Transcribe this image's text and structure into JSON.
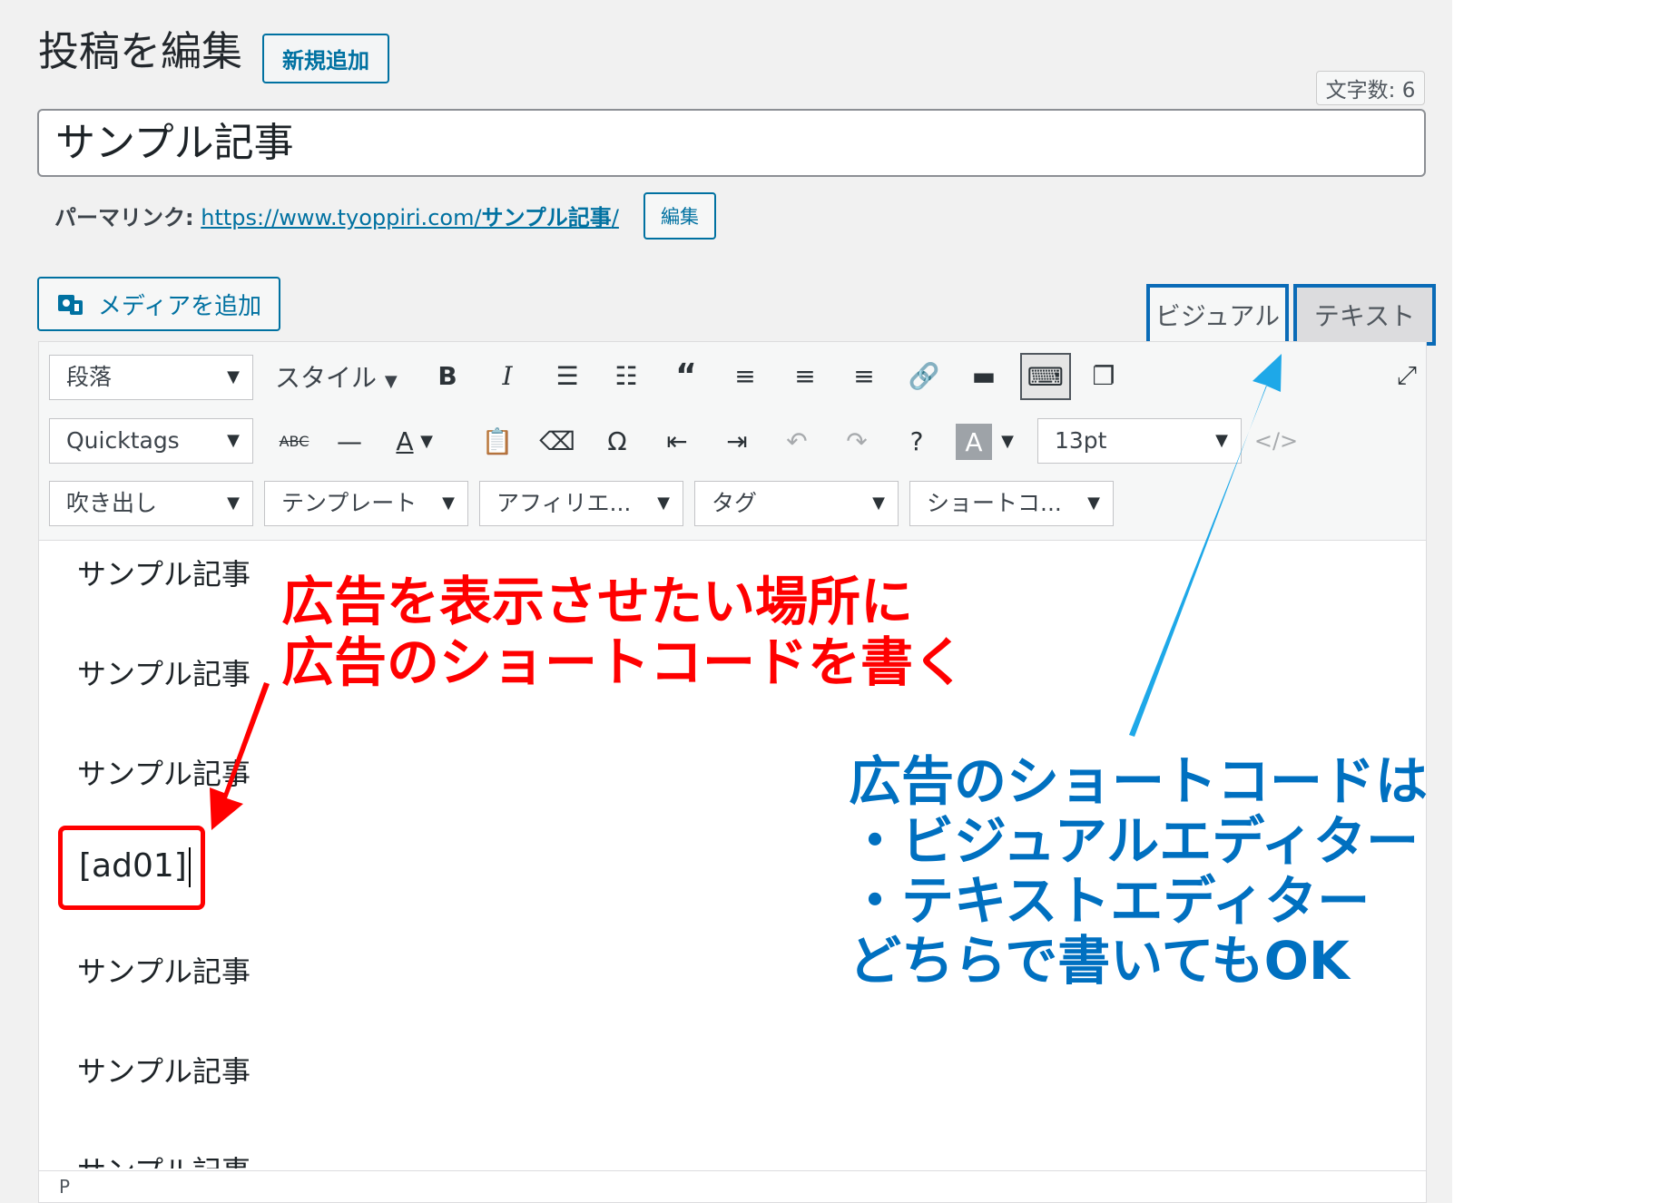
{
  "header": {
    "title": "投稿を編集",
    "add_new_label": "新規追加",
    "word_count": "文字数: 6"
  },
  "post": {
    "title": "サンプル記事"
  },
  "permalink": {
    "label": "パーマリンク:",
    "url_base": "https://www.tyoppiri.com/",
    "slug": "サンプル記事",
    "url_tail": "/",
    "edit_label": "編集"
  },
  "media": {
    "add_label": "メディアを追加"
  },
  "editor_tabs": {
    "visual": "ビジュアル",
    "text": "テキスト"
  },
  "toolbar": {
    "format_select": "段落",
    "styles_label": "スタイル",
    "quicktags_select": "Quicktags",
    "font_size_select": "13pt",
    "row3": [
      "吹き出し",
      "テンプレート",
      "アフィリエ...",
      "タグ",
      "ショートコ..."
    ]
  },
  "content": {
    "paragraphs": [
      "サンプル記事",
      "サンプル記事",
      "サンプル記事",
      "[ad01]",
      "サンプル記事",
      "サンプル記事",
      "サンプル記事"
    ]
  },
  "status_path": "P",
  "annotations": {
    "red_lines": [
      "広告を表示させたい場所に",
      "広告のショートコードを書く"
    ],
    "blue_lines": [
      "広告のショートコードは",
      "・ビジュアルエディター",
      "・テキストエディター",
      "どちらで書いてもOK"
    ]
  },
  "colors": {
    "accent": "#0071a1",
    "highlight_red": "#ff0000",
    "annotation_blue": "#0070c0",
    "arrow_blue": "#1ea8e8"
  }
}
